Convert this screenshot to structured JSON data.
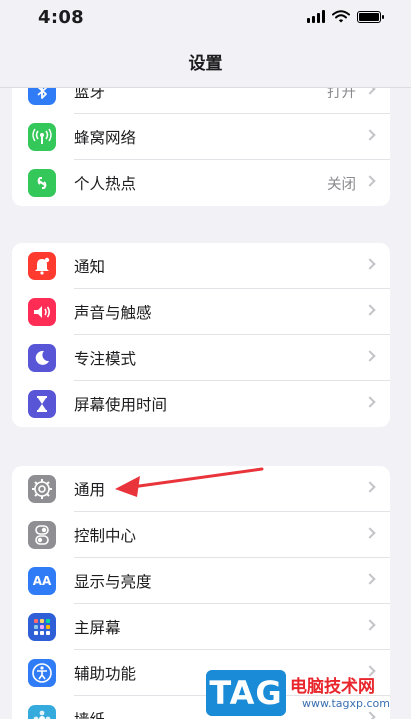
{
  "status": {
    "time": "4:08"
  },
  "nav": {
    "title": "设置"
  },
  "groups": [
    {
      "items": [
        {
          "label": "蓝牙",
          "value": "打开",
          "icon": "bluetooth-icon",
          "color": "#2f7cf6"
        },
        {
          "label": "蜂窝网络",
          "value": "",
          "icon": "cellular-icon",
          "color": "#34c759"
        },
        {
          "label": "个人热点",
          "value": "关闭",
          "icon": "hotspot-icon",
          "color": "#34c759"
        }
      ]
    },
    {
      "items": [
        {
          "label": "通知",
          "value": "",
          "icon": "bell-icon",
          "color": "#ff3b30"
        },
        {
          "label": "声音与触感",
          "value": "",
          "icon": "speaker-icon",
          "color": "#ff2d55"
        },
        {
          "label": "专注模式",
          "value": "",
          "icon": "moon-icon",
          "color": "#5856d6"
        },
        {
          "label": "屏幕使用时间",
          "value": "",
          "icon": "hourglass-icon",
          "color": "#5856d6"
        }
      ]
    },
    {
      "items": [
        {
          "label": "通用",
          "value": "",
          "icon": "gear-icon",
          "color": "#8e8e93"
        },
        {
          "label": "控制中心",
          "value": "",
          "icon": "toggles-icon",
          "color": "#8e8e93"
        },
        {
          "label": "显示与亮度",
          "value": "",
          "icon": "aa-icon",
          "color": "#2f7cf6",
          "icon_text": "AA"
        },
        {
          "label": "主屏幕",
          "value": "",
          "icon": "home-grid-icon",
          "color": "#2f5fd6"
        },
        {
          "label": "辅助功能",
          "value": "",
          "icon": "accessibility-icon",
          "color": "#2f7cf6"
        },
        {
          "label": "墙纸",
          "value": "",
          "icon": "wallpaper-icon",
          "color": "#35aadc"
        }
      ]
    }
  ],
  "annotation": {
    "arrow_color": "#e8343a",
    "target": "通用"
  },
  "watermark": {
    "badge": "TAG",
    "site_name": "电脑技术网",
    "url": "www.tagxp.com"
  }
}
